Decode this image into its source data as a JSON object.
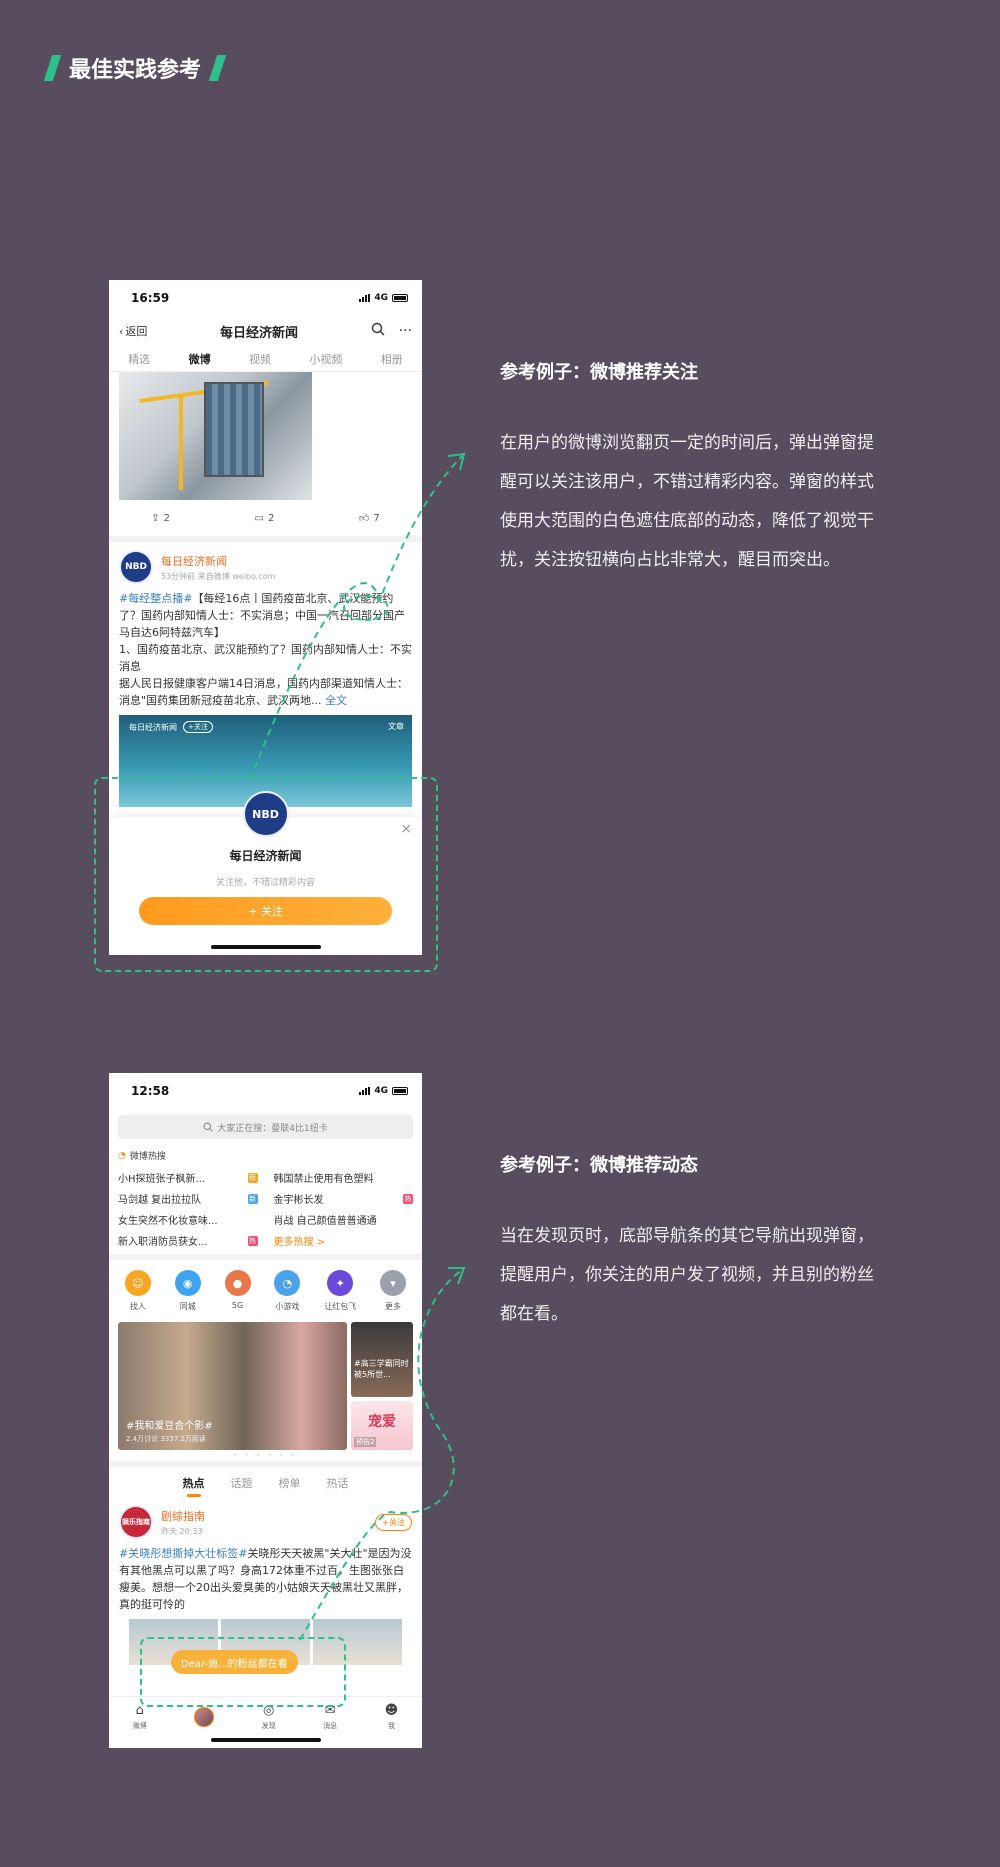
{
  "header": {
    "title": "最佳实践参考"
  },
  "example1": {
    "heading": "参考例子：微博推荐关注",
    "description": "在用户的微博浏览翻页一定的时间后，弹出弹窗提醒可以关注该用户，不错过精彩内容。弹窗的样式使用大范围的白色遮住底部的动态，降低了视觉干扰，关注按钮横向占比非常大，醒目而突出。"
  },
  "example2": {
    "heading": "参考例子：微博推荐动态",
    "description": "当在发现页时，底部导航条的其它导航出现弹窗，提醒用户，你关注的用户发了视频，并且别的粉丝都在看。"
  },
  "phone1": {
    "time": "16:59",
    "network": "4G",
    "back_label": "返回",
    "title": "每日经济新闻",
    "more_icon": "···",
    "tabs": [
      "精选",
      "微博",
      "视频",
      "小视频",
      "相册"
    ],
    "actions": {
      "share": "2",
      "comment": "2",
      "like": "7"
    },
    "post": {
      "avatar": "NBD",
      "name": "每日经济新闻",
      "meta": "53分钟前  来自微博 weibo.com",
      "tag": "#每经整点播#",
      "text1": "【每经16点丨国药疫苗北京、武汉能预约了？国药内部知情人士：不实消息；中国一汽召回部分国产马自达6阿特兹汽车】",
      "text2": "1、国药疫苗北京、武汉能预约了？国药内部知情人士：不实消息",
      "text3": "据人民日报健康客户端14日消息，国药内部渠道知情人士：消息\"国药集团新冠疫苗北京、武汉两地...",
      "more_link": "全文",
      "video_label": "每日经济新闻",
      "video_follow": "+关注",
      "video_right": "文章"
    },
    "popup": {
      "name": "每日经济新闻",
      "subtitle": "关注他，不错过精彩内容",
      "button": "+ 关注",
      "close": "×"
    }
  },
  "phone2": {
    "time": "12:58",
    "network": "4G",
    "search_placeholder": "大家正在搜：曼联4比1纽卡",
    "hot_title": "微博热搜",
    "hot_items": [
      {
        "text": "小H探班张子枫新...",
        "badge": "荐",
        "color": "#f5a623"
      },
      {
        "text": "韩国禁止使用有色塑料",
        "badge": "",
        "color": ""
      },
      {
        "text": "马剑越 复出拉拉队",
        "badge": "新",
        "color": "#4aa3e8"
      },
      {
        "text": "金宇彬长发",
        "badge": "热",
        "color": "#f0506e"
      },
      {
        "text": "女生突然不化妆意味...",
        "badge": "",
        "color": ""
      },
      {
        "text": "肖战 自己颜值普普通通",
        "badge": "",
        "color": ""
      },
      {
        "text": "新入职消防员获女...",
        "badge": "热",
        "color": "#f0506e"
      },
      {
        "text": "更多热搜 >",
        "badge": "",
        "color": ""
      }
    ],
    "icons": [
      {
        "label": "找人",
        "color": "#f5a623",
        "glyph": "☺"
      },
      {
        "label": "同城",
        "color": "#3ea3f0",
        "glyph": "◉"
      },
      {
        "label": "5G",
        "color": "#e8774a",
        "glyph": "●"
      },
      {
        "label": "小游戏",
        "color": "#4aa3e8",
        "glyph": "◔"
      },
      {
        "label": "让红包飞",
        "color": "#6a4ad8",
        "glyph": "✦"
      },
      {
        "label": "更多",
        "color": "#9aa1ad",
        "glyph": "▾"
      }
    ],
    "banner": {
      "caption": "#我和爱豆合个影#",
      "sub": "2.4万讨论  3337.2万阅读",
      "side1": "#高三学霸同时被5所世...",
      "side2_title": "宠爱",
      "side2_tag": "预告2"
    },
    "dots": "• • • • • •",
    "tabs": [
      "热点",
      "话题",
      "榜单",
      "热话"
    ],
    "post": {
      "avatar": "娱乐指南",
      "name": "剧综指南",
      "meta": "昨天 20:33",
      "follow": "+关注",
      "tag": "#关晓彤想撕掉大壮标签#",
      "text": "关晓彤天天被黑\"关大壮\"是因为没有其他黑点可以黑了吗？身高172体重不过百，生图张张白瘦美。想想一个20出头爱臭美的小姑娘天天被黑壮又黑胖，真的挺可怜的"
    },
    "toast": "Dear-迪...的粉丝都在看",
    "tabbar": [
      {
        "label": "微博",
        "icon": "⌂"
      },
      {
        "label": "",
        "icon": "avatar"
      },
      {
        "label": "发现",
        "icon": "◎"
      },
      {
        "label": "消息",
        "icon": "✉"
      },
      {
        "label": "我",
        "icon": "☻"
      }
    ]
  },
  "colors": {
    "accent": "#2ec08a",
    "orange": "#ff8200",
    "background": "#574d5e"
  }
}
